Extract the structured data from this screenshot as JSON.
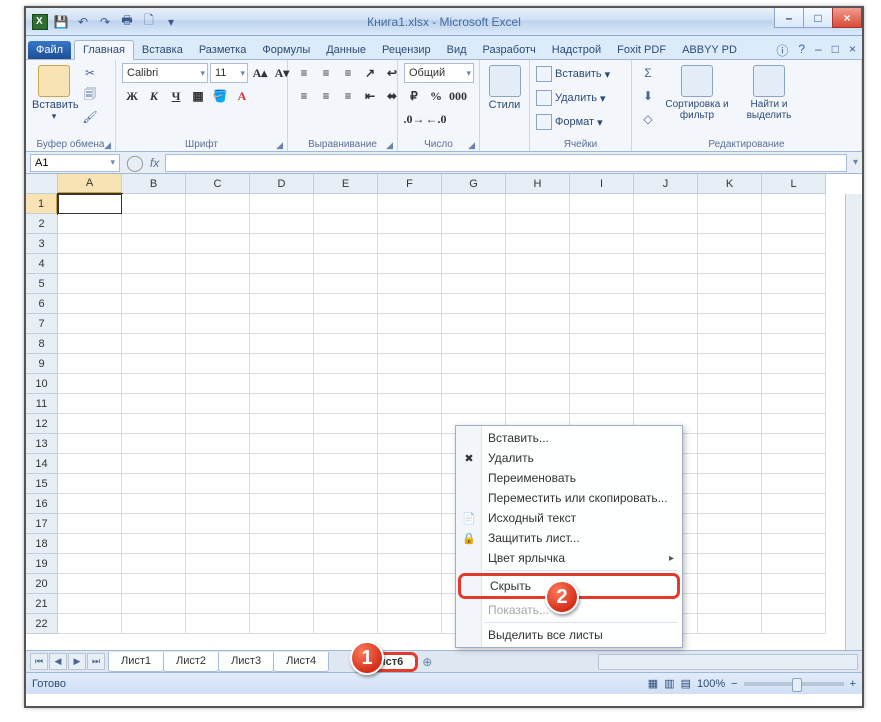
{
  "window": {
    "title": "Книга1.xlsx - Microsoft Excel"
  },
  "tabs": {
    "file": "Файл",
    "home": "Главная",
    "insert": "Вставка",
    "layout": "Разметка",
    "formulas": "Формулы",
    "data": "Данные",
    "review": "Рецензир",
    "view": "Вид",
    "developer": "Разработч",
    "addins": "Надстрой",
    "foxit": "Foxit PDF",
    "abbyy": "ABBYY PD"
  },
  "ribbon": {
    "clipboard": {
      "paste": "Вставить",
      "label": "Буфер обмена"
    },
    "font": {
      "name": "Calibri",
      "size": "11",
      "label": "Шрифт"
    },
    "alignment": {
      "label": "Выравнивание"
    },
    "number": {
      "format": "Общий",
      "label": "Число"
    },
    "styles": {
      "btn": "Стили",
      "label": ""
    },
    "cells": {
      "insert": "Вставить",
      "delete": "Удалить",
      "format": "Формат",
      "label": "Ячейки"
    },
    "editing": {
      "sort": "Сортировка и фильтр",
      "find": "Найти и выделить",
      "label": "Редактирование"
    }
  },
  "namebox": "A1",
  "columns": [
    "A",
    "B",
    "C",
    "D",
    "E",
    "F",
    "G",
    "H",
    "I",
    "J",
    "K",
    "L"
  ],
  "rows": [
    "1",
    "2",
    "3",
    "4",
    "5",
    "6",
    "7",
    "8",
    "9",
    "10",
    "11",
    "12",
    "13",
    "14",
    "15",
    "16",
    "17",
    "18",
    "19",
    "20",
    "21",
    "22"
  ],
  "sheets": [
    "Лист1",
    "Лист2",
    "Лист3",
    "Лист4",
    "",
    "Лист6"
  ],
  "active_sheet_index": 5,
  "context_menu": {
    "insert": "Вставить...",
    "delete": "Удалить",
    "rename": "Переименовать",
    "move": "Переместить или скопировать...",
    "source": "Исходный текст",
    "protect": "Защитить лист...",
    "tabcolor": "Цвет ярлычка",
    "hide": "Скрыть",
    "show": "Показать...",
    "selectall": "Выделить все листы"
  },
  "status": {
    "ready": "Готово",
    "zoom": "100%"
  },
  "markers": {
    "one": "1",
    "two": "2"
  }
}
